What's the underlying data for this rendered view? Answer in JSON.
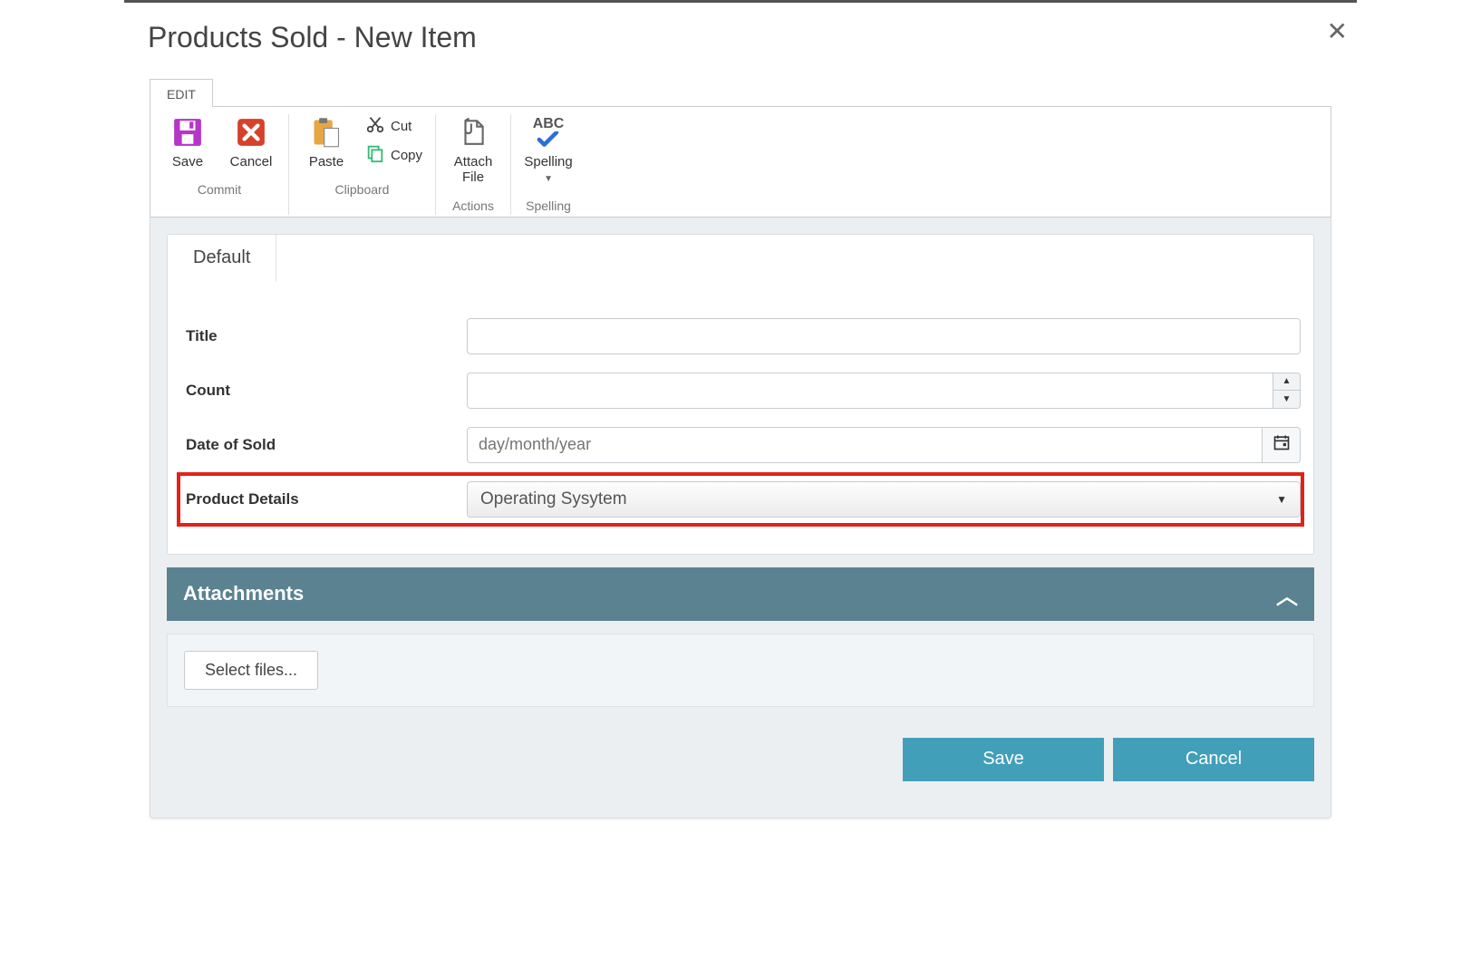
{
  "title": "Products Sold - New Item",
  "ribbon": {
    "tab": "EDIT",
    "commit": {
      "label": "Commit",
      "save": "Save",
      "cancel": "Cancel"
    },
    "clipboard": {
      "label": "Clipboard",
      "paste": "Paste",
      "cut": "Cut",
      "copy": "Copy"
    },
    "actions": {
      "label": "Actions",
      "attach": "Attach\nFile"
    },
    "spelling": {
      "label": "Spelling",
      "button": "Spelling",
      "abc": "ABC"
    }
  },
  "form": {
    "tab": "Default",
    "fields": {
      "title": {
        "label": "Title",
        "value": ""
      },
      "count": {
        "label": "Count",
        "value": ""
      },
      "date_of_sold": {
        "label": "Date of Sold",
        "placeholder": "day/month/year",
        "value": ""
      },
      "product_details": {
        "label": "Product Details",
        "value": "Operating Sysytem"
      }
    }
  },
  "attachments": {
    "header": "Attachments",
    "select_files": "Select files..."
  },
  "footer": {
    "save": "Save",
    "cancel": "Cancel"
  }
}
